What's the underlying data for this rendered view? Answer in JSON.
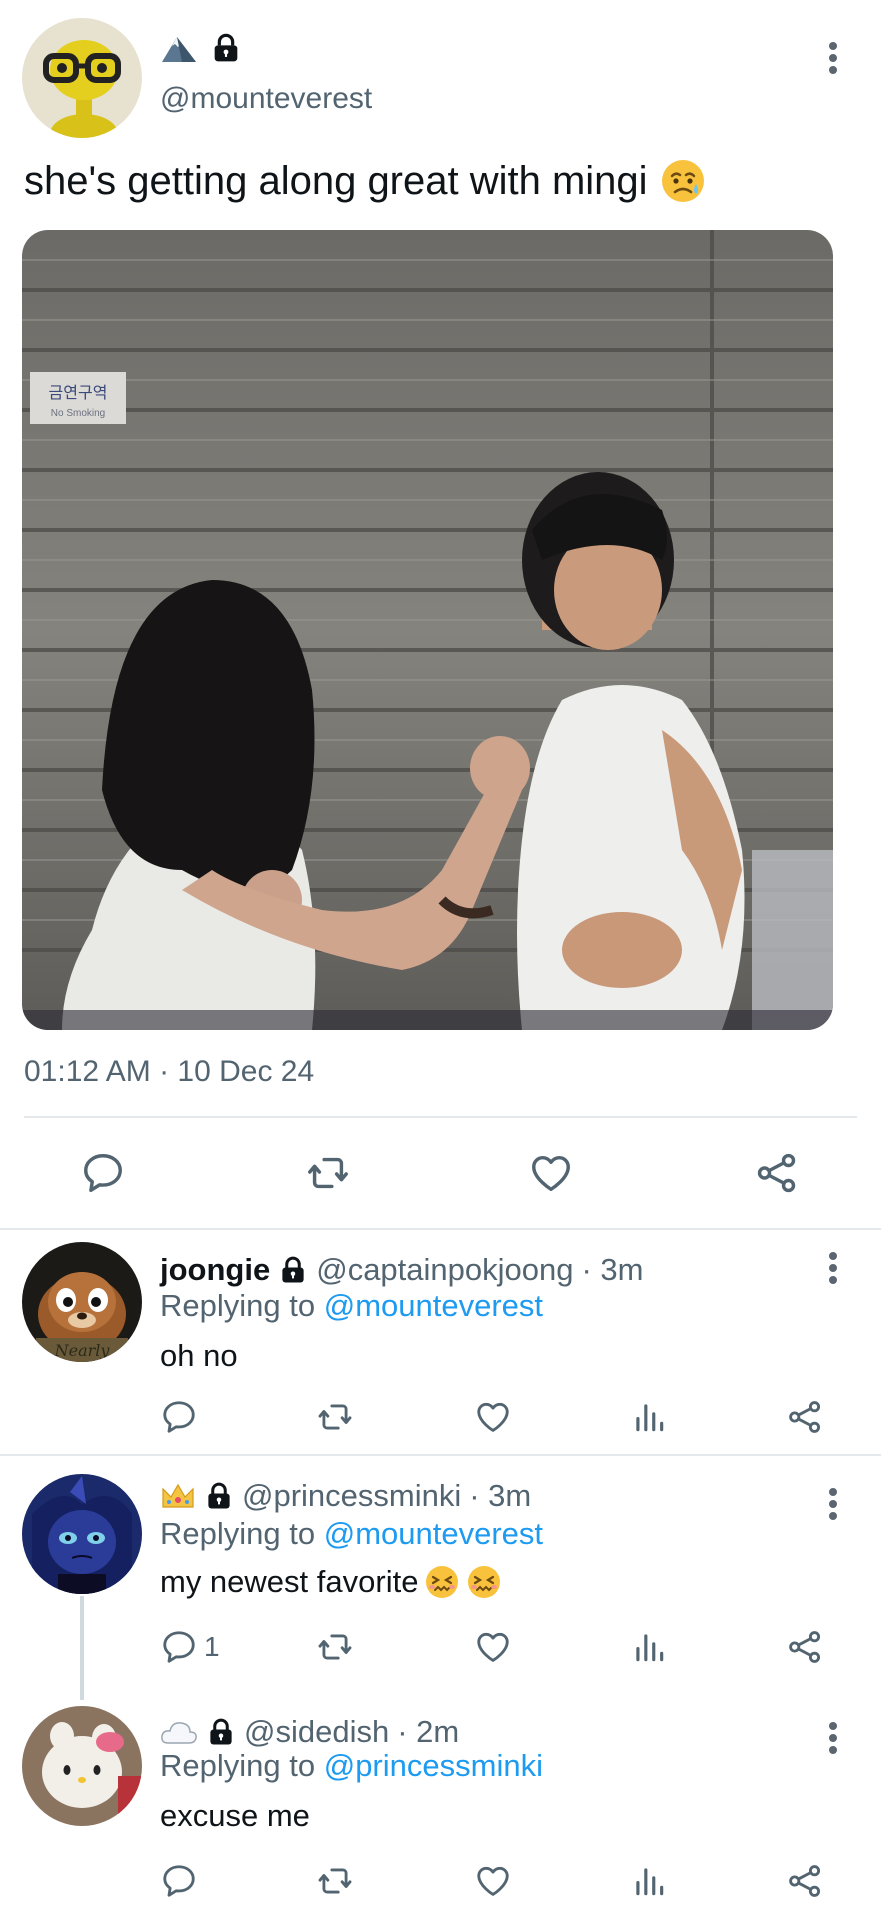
{
  "main_tweet": {
    "handle": "@mounteverest",
    "badges": [
      "mountain-emoji",
      "lock-icon"
    ],
    "text": "she's getting along great with mingi",
    "text_emoji": "sad-but-relieved-face-emoji",
    "photo_sign": {
      "korean": "금연구역",
      "english": "No Smoking"
    },
    "timestamp": "01:12 AM · 10 Dec 24"
  },
  "replies": [
    {
      "name": "joongie",
      "handle": "@captainpokjoong",
      "time": "· 3m",
      "replying_prefix": "Replying to",
      "replying_to": "@mounteverest",
      "text": "oh no",
      "reply_count": "",
      "avatar_caption": "Nearly"
    },
    {
      "name": "",
      "handle": "@princessminki",
      "time": "· 3m",
      "replying_prefix": "Replying to",
      "replying_to": "@mounteverest",
      "text": "my newest favorite",
      "reply_count": "1",
      "badges": [
        "crown-emoji",
        "lock-icon"
      ]
    },
    {
      "name": "",
      "handle": "@sidedish",
      "time": "· 2m",
      "replying_prefix": "Replying to",
      "replying_to": "@princessminki",
      "text": "excuse me",
      "reply_count": "",
      "badges": [
        "cloud-emoji",
        "lock-icon"
      ]
    }
  ],
  "colors": {
    "text": "#0f1419",
    "secondary": "#536471",
    "link": "#1d9bf0",
    "divider": "#e6e9ec"
  },
  "icons": [
    "reply-icon",
    "retweet-icon",
    "like-icon",
    "views-icon",
    "share-icon",
    "more-icon",
    "lock-icon"
  ]
}
